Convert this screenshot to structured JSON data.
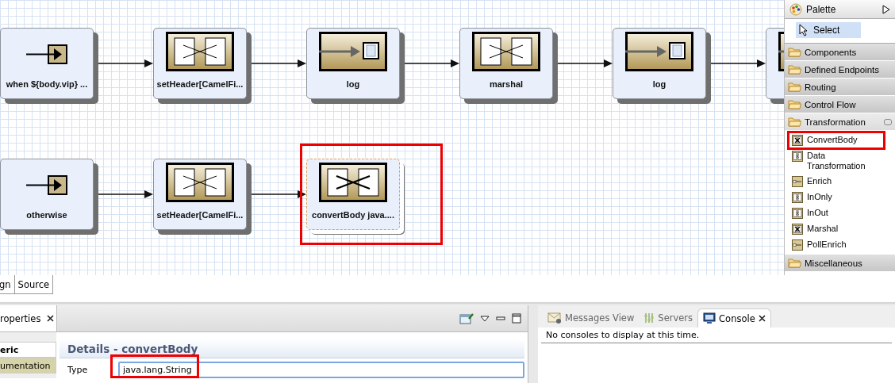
{
  "diagram": {
    "routes": [
      {
        "nodes": [
          {
            "kind": "entry",
            "label": "when ${body.vip} ...",
            "selected": false
          },
          {
            "kind": "transform",
            "label": "setHeader[CamelFi...",
            "selected": false
          },
          {
            "kind": "log",
            "label": "log",
            "selected": false
          },
          {
            "kind": "transform",
            "label": "marshal",
            "selected": false
          },
          {
            "kind": "log",
            "label": "log",
            "selected": false
          },
          {
            "kind": "log",
            "selected": false
          }
        ]
      },
      {
        "nodes": [
          {
            "kind": "entry",
            "label": "otherwise",
            "selected": false
          },
          {
            "kind": "transform",
            "label": "setHeader[CamelFi...",
            "selected": false
          },
          {
            "kind": "transform",
            "label": "convertBody java....",
            "selected": true,
            "highlighted": true
          }
        ]
      }
    ]
  },
  "palette": {
    "title": "Palette",
    "tool": {
      "label": "Select",
      "selected": true
    },
    "drawers": [
      {
        "label": "Components",
        "expanded": false
      },
      {
        "label": "Defined Endpoints",
        "expanded": false
      },
      {
        "label": "Routing",
        "expanded": false
      },
      {
        "label": "Control Flow",
        "expanded": false
      },
      {
        "label": "Transformation",
        "expanded": true,
        "items": [
          {
            "label": "ConvertBody",
            "kind": "cross",
            "highlighted": true
          },
          {
            "label": "Data Transformation",
            "kind": "split",
            "highlighted": false
          },
          {
            "label": "Enrich",
            "kind": "bar",
            "highlighted": false
          },
          {
            "label": "InOnly",
            "kind": "split",
            "highlighted": false
          },
          {
            "label": "InOut",
            "kind": "split",
            "highlighted": false
          },
          {
            "label": "Marshal",
            "kind": "cross",
            "highlighted": false
          },
          {
            "label": "PollEnrich",
            "kind": "bar",
            "highlighted": false
          }
        ]
      },
      {
        "label": "Miscellaneous",
        "expanded": false
      }
    ]
  },
  "editor_tabs": [
    {
      "label": "gn",
      "selected": true
    },
    {
      "label": "Source",
      "selected": false
    }
  ],
  "properties": {
    "tab": "roperties",
    "side_tabs": [
      {
        "label": "eric",
        "selected": true
      },
      {
        "label": "umentation",
        "selected": false
      }
    ],
    "heading": "Details - convertBody",
    "field": {
      "label": "Type",
      "value": "java.lang.String",
      "highlighted": true
    }
  },
  "console": {
    "tabs": [
      {
        "label": "Messages View",
        "kind": "messages",
        "selected": false
      },
      {
        "label": "Servers",
        "kind": "servers",
        "selected": false
      },
      {
        "label": "Console",
        "kind": "console",
        "selected": true
      }
    ],
    "message": "No consoles to display at this time."
  }
}
